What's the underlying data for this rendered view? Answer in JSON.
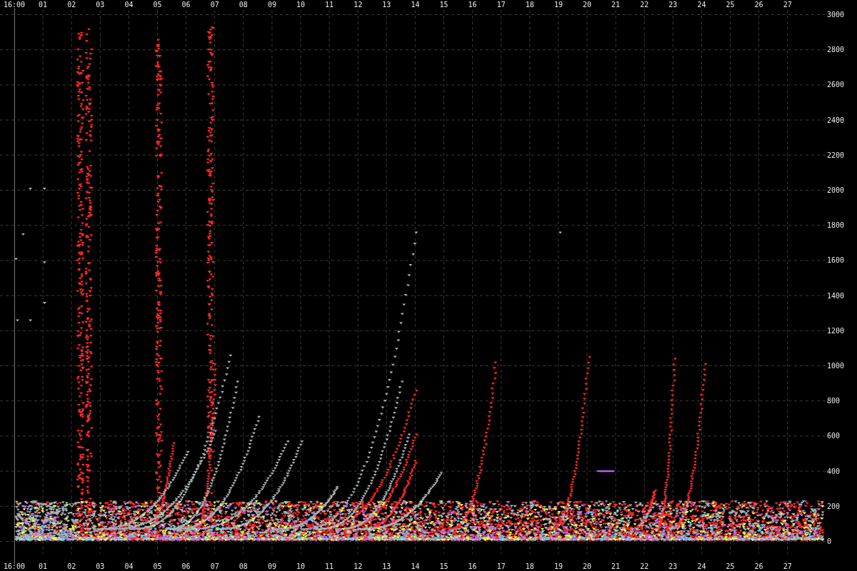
{
  "chart": {
    "x_axis_top_labels": [
      "16:00",
      "01",
      "02",
      "03",
      "04",
      "05",
      "06",
      "07",
      "08",
      "09",
      "10",
      "11",
      "12",
      "13",
      "14",
      "15",
      "16",
      "17",
      "18",
      "19",
      "20",
      "21",
      "22",
      "23",
      "24",
      "25",
      "26",
      "27"
    ],
    "x_axis_bottom_labels": [
      "16:00",
      "01",
      "02",
      "03",
      "04",
      "05",
      "06",
      "07",
      "08",
      "09",
      "10",
      "11",
      "12",
      "13",
      "14",
      "15",
      "16",
      "17",
      "18",
      "19",
      "20",
      "21",
      "22",
      "23",
      "24",
      "25",
      "26",
      "27"
    ],
    "y_axis_labels": [
      "3000",
      "2800",
      "2600",
      "2400",
      "2200",
      "2000",
      "1800",
      "1600",
      "1400",
      "1200",
      "1000",
      "800",
      "600",
      "400",
      "200",
      "0"
    ]
  }
}
